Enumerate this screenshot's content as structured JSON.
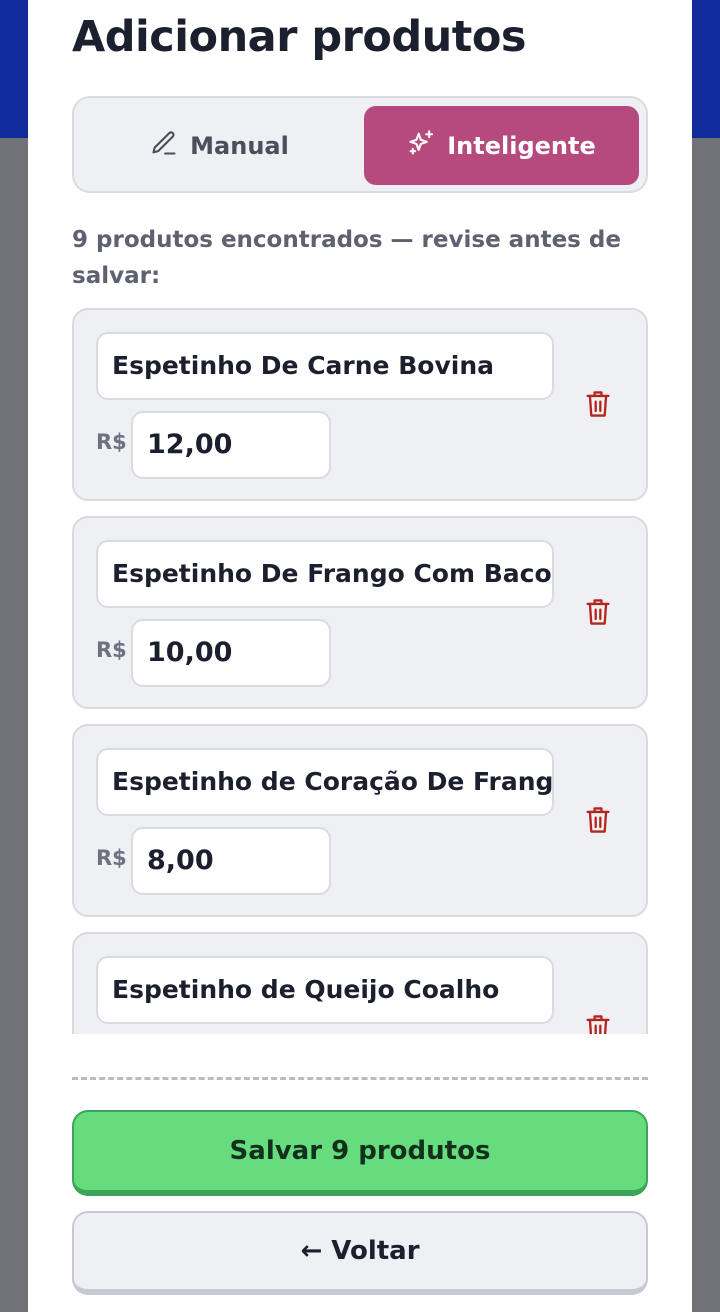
{
  "header": {
    "title": "Adicionar produtos"
  },
  "mode_toggle": {
    "manual_label": "Manual",
    "smart_label": "Inteligente",
    "active": "smart"
  },
  "status_text": "9 produtos encontrados — revise antes de salvar:",
  "currency_symbol": "R$",
  "products": [
    {
      "name": "Espetinho De Carne Bovina",
      "price": "12,00"
    },
    {
      "name": "Espetinho De Frango Com Bacon",
      "price": "10,00"
    },
    {
      "name": "Espetinho de Coração De Frango",
      "price": "8,00"
    },
    {
      "name": "Espetinho de Queijo Coalho",
      "price": ""
    }
  ],
  "footer": {
    "save_label": "Salvar 9 produtos",
    "back_label": "← Voltar"
  },
  "colors": {
    "accent_smart": "#b64a7e",
    "save_green": "#66dc7e",
    "trash_red": "#b3261e",
    "backdrop_blue": "#0f2b9c"
  },
  "icons": {
    "manual": "pencil-icon",
    "smart": "sparkles-icon",
    "delete": "trash-icon"
  }
}
